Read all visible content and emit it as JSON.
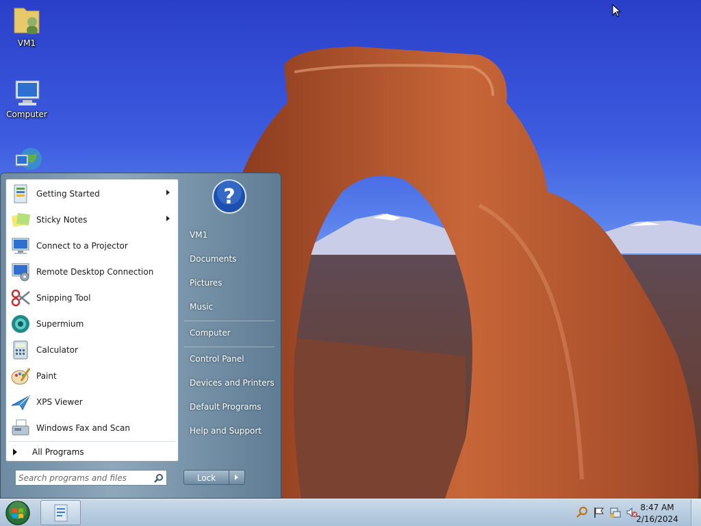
{
  "desktop": {
    "icons": [
      {
        "label": "VM1",
        "icon": "user-folder-icon"
      },
      {
        "label": "Computer",
        "icon": "computer-icon"
      },
      {
        "label": "",
        "icon": "network-globe-icon"
      }
    ]
  },
  "start_menu": {
    "programs": [
      {
        "label": "Getting Started",
        "icon": "getting-started-icon",
        "has_submenu": true
      },
      {
        "label": "Sticky Notes",
        "icon": "sticky-notes-icon",
        "has_submenu": true
      },
      {
        "label": "Connect to a Projector",
        "icon": "projector-icon",
        "has_submenu": false
      },
      {
        "label": "Remote Desktop Connection",
        "icon": "remote-desktop-icon",
        "has_submenu": false
      },
      {
        "label": "Snipping Tool",
        "icon": "scissors-icon",
        "has_submenu": false
      },
      {
        "label": "Supermium",
        "icon": "supermium-icon",
        "has_submenu": false
      },
      {
        "label": "Calculator",
        "icon": "calculator-icon",
        "has_submenu": false
      },
      {
        "label": "Paint",
        "icon": "paint-palette-icon",
        "has_submenu": false
      },
      {
        "label": "XPS Viewer",
        "icon": "xps-viewer-icon",
        "has_submenu": false
      },
      {
        "label": "Windows Fax and Scan",
        "icon": "fax-icon",
        "has_submenu": false
      }
    ],
    "all_programs": "All Programs",
    "search_placeholder": "Search programs and files",
    "places": {
      "group1": [
        "VM1",
        "Documents",
        "Pictures",
        "Music"
      ],
      "group2": [
        "Computer"
      ],
      "group3": [
        "Control Panel",
        "Devices and Printers",
        "Default Programs",
        "Help and Support"
      ]
    },
    "lock_label": "Lock"
  },
  "taskbar": {
    "clock_time": "8:47 AM",
    "clock_date": "2/16/2024",
    "tray_icons": [
      "search-icon",
      "action-center-flag-icon",
      "network-icon",
      "volume-muted-icon"
    ]
  },
  "colors": {
    "sky": "#3d5ce0",
    "rock": "#b5532b",
    "menu_frame": "#6d8aa2",
    "taskbar": "#b8cde0"
  }
}
